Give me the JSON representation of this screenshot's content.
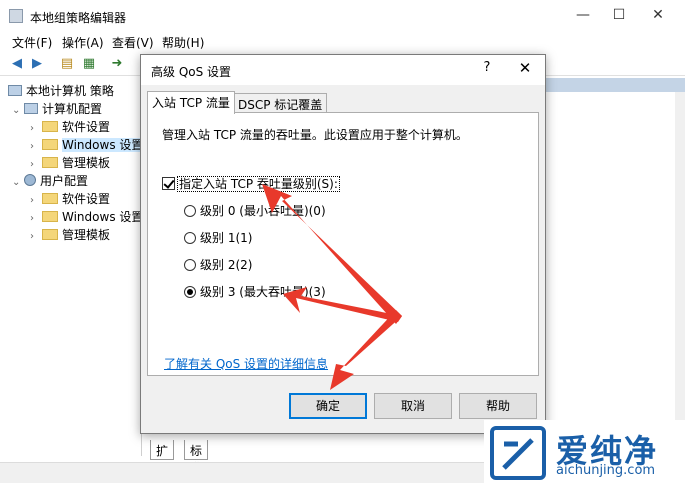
{
  "window": {
    "title": "本地组策略编辑器",
    "minimize": "—",
    "maximize": "☐",
    "close": "✕"
  },
  "menu": [
    "文件(F)",
    "操作(A)",
    "查看(V)",
    "帮助(H)"
  ],
  "toolbar": {
    "back": "◀",
    "forward": "▶",
    "up": "▤",
    "props": "▦",
    "export": "➜"
  },
  "tree": {
    "root": "本地计算机 策略",
    "computer": "计算机配置",
    "computer_children": [
      "软件设置",
      "Windows 设置",
      "管理模板"
    ],
    "user": "用户配置",
    "user_children": [
      "软件设置",
      "Windows 设置",
      "管理模板"
    ]
  },
  "bottom_tabs": [
    "扩展",
    "标准"
  ],
  "dialog": {
    "title": "高级 QoS 设置",
    "help": "?",
    "close": "✕",
    "tabs": [
      "入站 TCP 流量",
      "DSCP 标记覆盖"
    ],
    "description": "管理入站 TCP 流量的吞吐量。此设置应用于整个计算机。",
    "checkbox_label": "指定入站 TCP 吞吐量级别(S):",
    "checkbox_checked": true,
    "radios": [
      {
        "label": "级别 0 (最小吞吐量)(0)",
        "selected": false
      },
      {
        "label": "级别 1(1)",
        "selected": false
      },
      {
        "label": "级别 2(2)",
        "selected": false
      },
      {
        "label": "级别 3 (最大吞吐量)(3)",
        "selected": true
      }
    ],
    "link": "了解有关 QoS 设置的详细信息",
    "buttons": {
      "ok": "确定",
      "cancel": "取消",
      "help": "帮助"
    }
  },
  "watermark": {
    "brand": "爱纯净",
    "url": "aichunjing.com"
  },
  "colors": {
    "accent": "#0078d7",
    "arrow": "#e8392b",
    "link": "#0066cc",
    "brand": "#1a5fa8"
  }
}
